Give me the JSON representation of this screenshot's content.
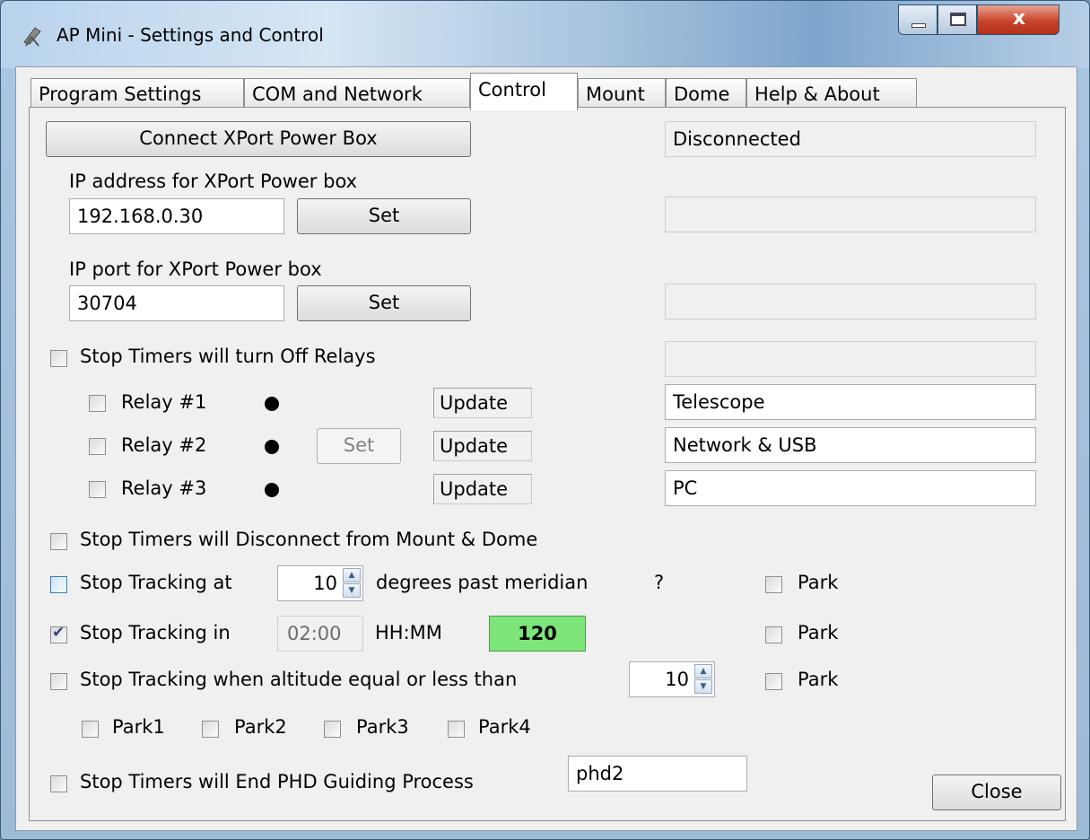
{
  "window": {
    "title": "AP Mini - Settings and Control",
    "close_glyph": "x"
  },
  "tabs": [
    {
      "label": "Program Settings"
    },
    {
      "label": "COM and Network"
    },
    {
      "label": "Control"
    },
    {
      "label": "Mount"
    },
    {
      "label": "Dome"
    },
    {
      "label": "Help & About"
    }
  ],
  "control": {
    "connect_button": "Connect XPort Power Box",
    "connection_status": "Disconnected",
    "ip_address_label": "IP address for XPort Power box",
    "ip_address_value": "192.168.0.30",
    "ip_set_button": "Set",
    "ip_port_label": "IP port for XPort Power box",
    "ip_port_value": "30704",
    "port_set_button": "Set",
    "stop_relays_label": "Stop Timers will turn Off Relays",
    "relays": [
      {
        "label": "Relay #1",
        "update": "Update",
        "name": "Telescope"
      },
      {
        "label": "Relay #2",
        "update": "Update",
        "name": "Network & USB",
        "set": "Set"
      },
      {
        "label": "Relay #3",
        "update": "Update",
        "name": "PC"
      }
    ],
    "stop_disconnect_label": "Stop Timers will Disconnect from Mount & Dome",
    "meridian": {
      "label": "Stop Tracking at",
      "value": "10",
      "suffix": "degrees past meridian",
      "help": "?",
      "park": "Park"
    },
    "time": {
      "label": "Stop Tracking in",
      "value": "02:00",
      "unit": "HH:MM",
      "minutes": "120",
      "park": "Park",
      "checked": true
    },
    "altitude": {
      "label": "Stop Tracking when altitude equal or less than",
      "value": "10",
      "park": "Park"
    },
    "parks": [
      "Park1",
      "Park2",
      "Park3",
      "Park4"
    ],
    "phd": {
      "label": "Stop Timers will End PHD Guiding Process",
      "value": "phd2"
    },
    "close_button": "Close"
  }
}
